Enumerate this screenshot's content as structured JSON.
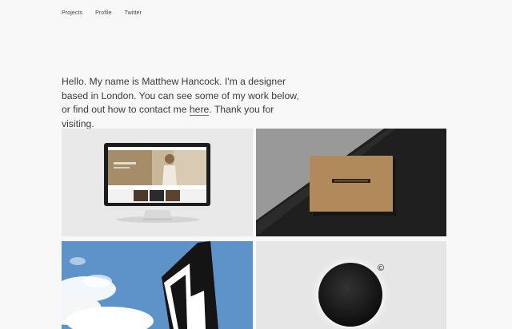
{
  "nav": {
    "items": [
      {
        "label": "Projects"
      },
      {
        "label": "Profile"
      },
      {
        "label": "Twitter"
      }
    ]
  },
  "intro": {
    "before_link": "Hello. My name is Matthew Hancock. I'm a designer based in London. You can see some of my work below, or find out how to contact me ",
    "link_label": "here",
    "after_link": ". Thank you for visiting."
  },
  "colors": {
    "background": "#f8f8f8",
    "text": "#3a3a3a",
    "card_brown": "#b08a5a",
    "sky_blue": "#5e93c9"
  },
  "tiles": [
    {
      "icon": "imac-website-mockup"
    },
    {
      "icon": "kraft-business-card"
    },
    {
      "icon": "black-flag-logo"
    },
    {
      "icon": "black-circle-copyright"
    }
  ],
  "copyright_symbol": "©"
}
